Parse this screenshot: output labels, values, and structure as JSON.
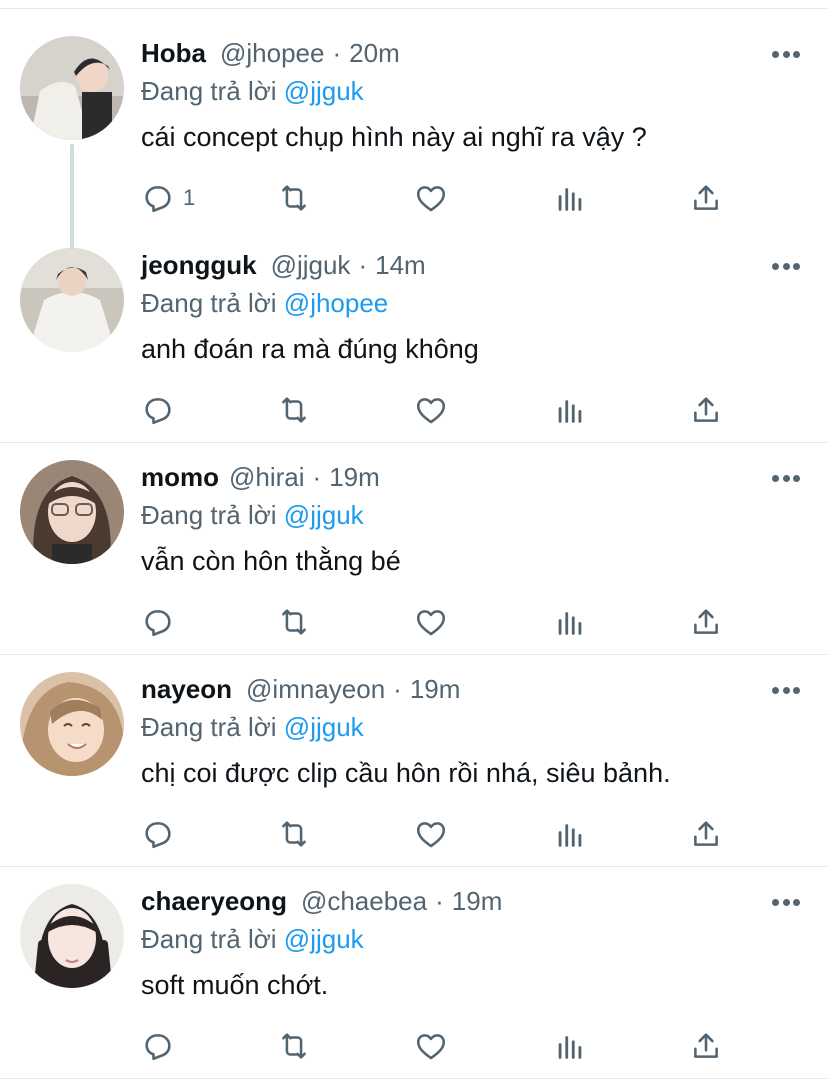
{
  "reply_prefix": "Đang trả lời",
  "tweets": [
    {
      "name": "Hoba",
      "handle": "@jhopee",
      "time": "20m",
      "reply_to": "@jjguk",
      "text": "cái concept chụp hình này ai nghĩ ra vậy ?",
      "reply_count": "1",
      "avatar_colors": [
        "#d8d6d0",
        "#2b2a2c",
        "#f1efe9"
      ]
    },
    {
      "name": "jeongguk",
      "handle": "@jjguk",
      "time": "14m",
      "reply_to": "@jhopee",
      "text": "anh đoán ra mà đúng không",
      "reply_count": "",
      "avatar_colors": [
        "#c9c3b8",
        "#3a3a3c",
        "#f4f2ee"
      ]
    },
    {
      "name": "momo",
      "handle": "@hirai",
      "time": "19m",
      "reply_to": "@jjguk",
      "text": "vẫn còn hôn thằng bé",
      "reply_count": "",
      "avatar_colors": [
        "#8a7363",
        "#4a3a30",
        "#f0d9cc"
      ]
    },
    {
      "name": "nayeon",
      "handle": "@imnayeon",
      "time": "19m",
      "reply_to": "@jjguk",
      "text": "chị coi được clip cầu hôn rồi nhá, siêu bảnh.",
      "reply_count": "",
      "avatar_colors": [
        "#c9a889",
        "#a07d5c",
        "#f4dcc9"
      ]
    },
    {
      "name": "chaeryeong",
      "handle": "@chaebea",
      "time": "19m",
      "reply_to": "@jjguk",
      "text": "soft muốn chớt.",
      "reply_count": "",
      "avatar_colors": [
        "#e8e6e3",
        "#2a2424",
        "#f6e6df"
      ]
    }
  ],
  "icons": {
    "reply": "reply-icon",
    "retweet": "retweet-icon",
    "like": "heart-icon",
    "stats": "stats-icon",
    "share": "share-icon",
    "more": "more-icon"
  },
  "colors": {
    "mention": "#1d9bf0",
    "secondary_text": "#536471",
    "primary_text": "#0f1419",
    "divider": "#e6e9eb"
  }
}
